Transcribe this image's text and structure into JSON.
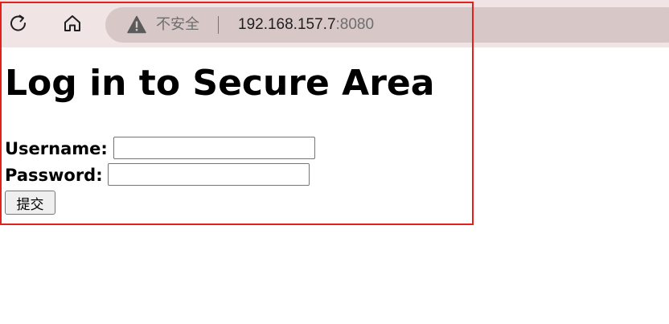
{
  "browser": {
    "reload_icon": "reload-icon",
    "home_icon": "home-icon",
    "address_bar": {
      "security_icon": "warning-triangle-icon",
      "security_text": "不安全",
      "url_host": "192.168.157.7",
      "url_port": ":8080"
    }
  },
  "page": {
    "title": "Log in to Secure Area",
    "form": {
      "username_label": "Username:",
      "username_value": "",
      "password_label": "Password:",
      "password_value": "",
      "submit_label": "提交"
    }
  },
  "colors": {
    "toolbar_bg": "#f0e4e4",
    "address_bar_bg": "#d8c7c7",
    "highlight_border": "#e3211c"
  }
}
